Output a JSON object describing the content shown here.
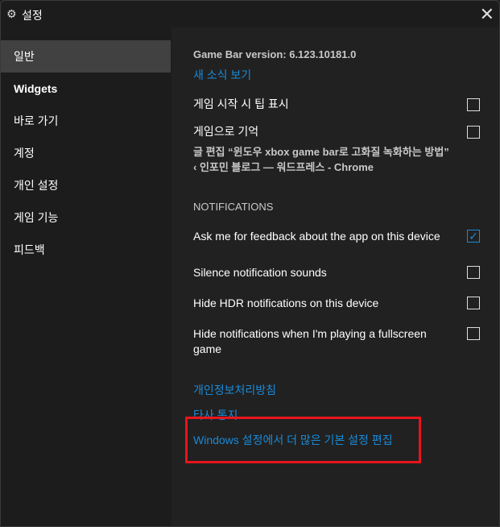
{
  "window": {
    "title": "설정",
    "icon": "gear-icon",
    "close_icon": "close-icon"
  },
  "sidebar": {
    "items": [
      {
        "label": "일반",
        "selected": true
      },
      {
        "label": "Widgets"
      },
      {
        "label": "바로 가기"
      },
      {
        "label": "계정"
      },
      {
        "label": "개인 설정"
      },
      {
        "label": "게임 기능"
      },
      {
        "label": "피드백"
      }
    ]
  },
  "main": {
    "version": "Game Bar version: 6.123.10181.0",
    "whats_new_link": "새 소식 보기",
    "general_options": [
      {
        "label": "게임 시작 시 팁 표시",
        "checked": false
      },
      {
        "label": "게임으로 기억",
        "checked": false
      }
    ],
    "remember_detail_line1": "글 편집 “윈도우 xbox game bar로 고화질 녹화하는 방법”",
    "remember_detail_line2": "‹ 인포민 블로그 — 워드프레스 - Chrome",
    "notifications_heading": "NOTIFICATIONS",
    "notification_options": [
      {
        "label": "Ask me for feedback about the app on this device",
        "checked": true
      },
      {
        "label": "Silence notification sounds",
        "checked": false
      },
      {
        "label": "Hide HDR notifications on this device",
        "checked": false
      },
      {
        "label": "Hide notifications when I'm playing a fullscreen game",
        "checked": false
      }
    ],
    "links": [
      "개인정보처리방침",
      "타사 통지",
      "Windows 설정에서 더 많은 기본 설정 편집"
    ]
  },
  "colors": {
    "accent": "#1a8ad8",
    "highlight_box": "#e8151b"
  }
}
